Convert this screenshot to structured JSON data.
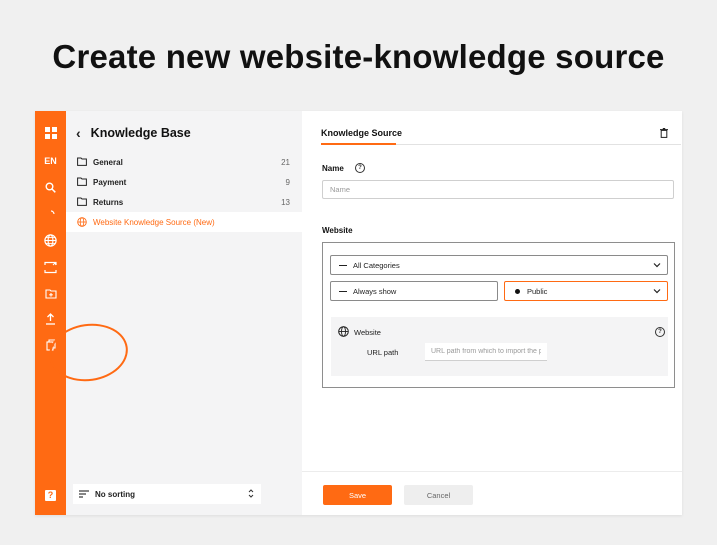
{
  "headline": "Create new website-knowledge source",
  "rail": {
    "lang": "EN",
    "help": "?"
  },
  "sidebar": {
    "title": "Knowledge Base",
    "items": [
      {
        "label": "General",
        "count": "21"
      },
      {
        "label": "Payment",
        "count": "9"
      },
      {
        "label": "Returns",
        "count": "13"
      },
      {
        "label": "Website Knowledge Source (New)",
        "count": ""
      }
    ],
    "sorting": "No sorting"
  },
  "main": {
    "tab": "Knowledge Source",
    "name_label": "Name",
    "name_placeholder": "Name",
    "website_label": "Website",
    "category_select": "All Categories",
    "visibility_select": "Always show",
    "access_select": "Public",
    "card_title": "Website",
    "url_path_label": "URL path",
    "url_placeholder": "URL path from which to import the p",
    "save": "Save",
    "cancel": "Cancel"
  },
  "colors": {
    "accent": "#ff6a13"
  }
}
